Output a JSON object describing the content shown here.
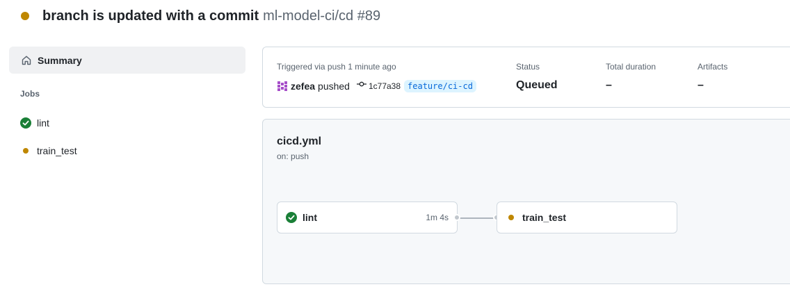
{
  "header": {
    "title": "branch is updated with a commit",
    "repo_run": "ml-model-ci/cd #89",
    "status_color": "#bf8700"
  },
  "sidebar": {
    "summary_label": "Summary",
    "summary_icon": "home-icon",
    "jobs_heading": "Jobs",
    "jobs": [
      {
        "label": "lint",
        "status": "success"
      },
      {
        "label": "train_test",
        "status": "queued"
      }
    ]
  },
  "summary": {
    "triggered_label": "Triggered via push 1 minute ago",
    "actor": "zefea",
    "action": "pushed",
    "commit_sha": "1c77a38",
    "branch": "feature/ci-cd",
    "status_label": "Status",
    "status_value": "Queued",
    "duration_label": "Total duration",
    "duration_value": "–",
    "artifacts_label": "Artifacts",
    "artifacts_value": "–"
  },
  "workflow": {
    "file": "cicd.yml",
    "trigger": "on: push",
    "jobs": [
      {
        "name": "lint",
        "status": "success",
        "duration": "1m 4s"
      },
      {
        "name": "train_test",
        "status": "queued",
        "duration": ""
      }
    ]
  },
  "colors": {
    "success": "#1a7f37",
    "pending": "#bf8700",
    "branch_bg": "#ddf4ff",
    "branch_fg": "#0969da"
  }
}
